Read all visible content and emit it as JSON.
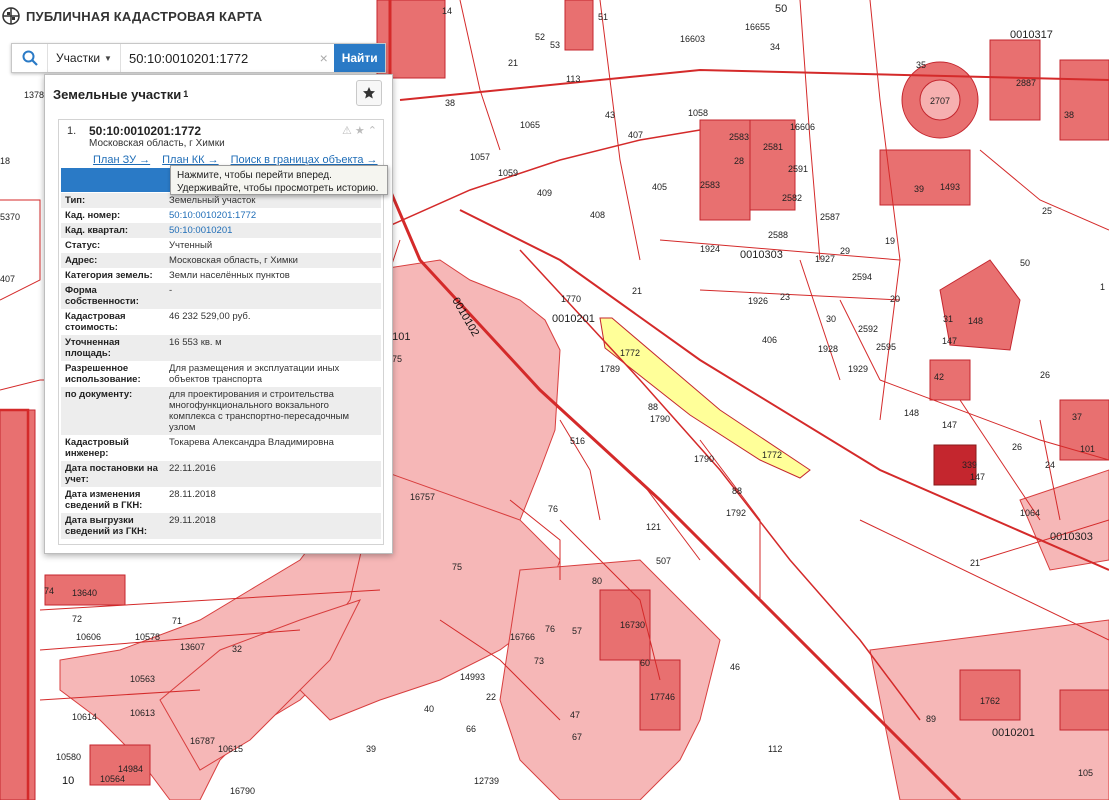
{
  "header": {
    "app_title": "ПУБЛИЧНАЯ КАДАСТРОВАЯ КАРТА"
  },
  "search": {
    "type_label": "Участки",
    "query": "50:10:0010201:1772",
    "clear": "×",
    "find_label": "Найти"
  },
  "panel": {
    "title": "Земельные участки",
    "count": "1",
    "item_number": "1.",
    "cadastral_number": "50:10:0010201:1772",
    "address_short": "Московская область, г Химки",
    "links": [
      "План ЗУ →",
      "План КК →",
      "Поиск в границах объекта →"
    ],
    "info_button": "Информация",
    "tooltip_line1": "Нажмите, чтобы перейти вперед.",
    "tooltip_line2": "Удерживайте, чтобы просмотреть историю.",
    "attributes": [
      {
        "key": "Тип:",
        "value": "Земельный участок"
      },
      {
        "key": "Кад. номер:",
        "value": "50:10:0010201:1772",
        "link": true
      },
      {
        "key": "Кад. квартал:",
        "value": "50:10:0010201",
        "link": true
      },
      {
        "key": "Статус:",
        "value": "Учтенный"
      },
      {
        "key": "Адрес:",
        "value": "Московская область, г Химки"
      },
      {
        "key": "Категория земель:",
        "value": "Земли населённых пунктов"
      },
      {
        "key": "Форма собственности:",
        "value": "-"
      },
      {
        "key": "Кадастровая стоимость:",
        "value": "46 232 529,00 руб."
      },
      {
        "key": "Уточненная площадь:",
        "value": "16 553 кв. м"
      },
      {
        "key": "Разрешенное использование:",
        "value": "Для размещения и эксплуатации иных объектов транспорта"
      },
      {
        "key": "по документу:",
        "value": "для проектирования и строительства многофункционального вокзального комплекса с транспортно-пересадочным узлом"
      },
      {
        "key": "Кадастровый инженер:",
        "value": "Токарева Александра Владимировна"
      },
      {
        "key": "Дата постановки на учет:",
        "value": "22.11.2016"
      },
      {
        "key": "Дата изменения сведений в ГКН:",
        "value": "28.11.2018"
      },
      {
        "key": "Дата выгрузки сведений из ГКН:",
        "value": "29.11.2018"
      }
    ]
  },
  "map": {
    "colors": {
      "border": "#d42a2a",
      "fill": "#f6b0b0",
      "fill_dark": "#e87070",
      "selected": "#ffff99",
      "building": "#c4262e"
    },
    "labels": [
      "50",
      "14",
      "34",
      "16603",
      "16655",
      "52",
      "53",
      "51",
      "21",
      "113",
      "1378",
      "0010317",
      "35",
      "2707",
      "2887",
      "38",
      "1065",
      "1058",
      "2583",
      "38",
      "407",
      "43",
      "16606",
      "2581",
      "1057",
      "1059",
      "409",
      "405",
      "2583",
      "28",
      "2582",
      "2591",
      "39",
      "1493",
      "25",
      "408",
      "1924",
      "2588",
      "2587",
      "19",
      "0010303",
      "1927",
      "29",
      "2594",
      "50",
      "0010102",
      "21",
      "1770",
      "1926",
      "23",
      "30",
      "0010201",
      "2592",
      "20",
      "1772",
      "406",
      "1928",
      "2595",
      "1929",
      "31",
      "148",
      "147",
      "26",
      "1789",
      "42",
      "88",
      "1790",
      "148",
      "147",
      "37",
      "101",
      "0101",
      "75",
      "339",
      "147",
      "24",
      "516",
      "1790",
      "1772",
      "26",
      "88",
      "16757",
      "1792",
      "1064",
      "76",
      "121",
      "0010303",
      "21",
      "507",
      "74",
      "13640",
      "71",
      "80",
      "57",
      "72",
      "10606",
      "10578",
      "16766",
      "76",
      "13607",
      "16730",
      "32",
      "10563",
      "73",
      "60",
      "14993",
      "22",
      "46",
      "10613",
      "40",
      "66",
      "47",
      "17746",
      "1762",
      "89",
      "10614",
      "67",
      "16787",
      "10615",
      "39",
      "112",
      "0010201",
      "10580",
      "14984",
      "10564",
      "16790",
      "12739",
      "105",
      "10",
      "1",
      "407",
      "5370",
      "18"
    ]
  }
}
